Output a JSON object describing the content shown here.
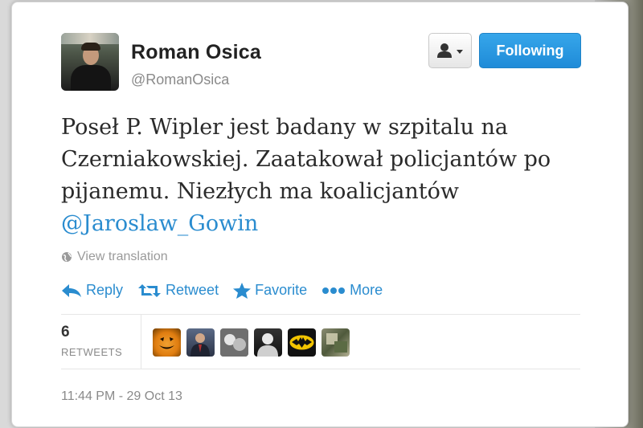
{
  "user": {
    "name": "Roman Osica",
    "handle": "@RomanOsica"
  },
  "buttons": {
    "follow_label": "Following"
  },
  "tweet": {
    "text": "Poseł P. Wipler jest badany w szpitalu na Czerniakowskiej. Zaatakował policjantów po pijanemu. Niezłych ma koalicjantów",
    "mention": "@Jaroslaw_Gowin",
    "view_translation": "View translation"
  },
  "actions": {
    "reply": "Reply",
    "retweet": "Retweet",
    "favorite": "Favorite",
    "more": "More"
  },
  "stats": {
    "retweets_count": "6",
    "retweets_label": "RETWEETS"
  },
  "timestamp": "11:44 PM - 29 Oct 13",
  "colors": {
    "link": "#2a8ccf",
    "follow_button": "#1f8bd8"
  },
  "icons": [
    "user-icon",
    "caret-down-icon",
    "globe-icon",
    "reply-icon",
    "retweet-icon",
    "star-icon",
    "more-dots-icon"
  ]
}
